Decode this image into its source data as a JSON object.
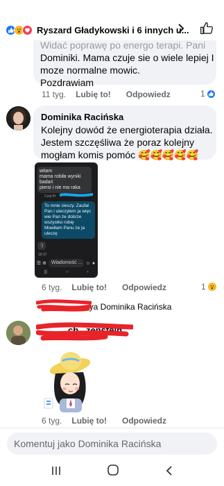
{
  "header": {
    "reactions": [
      "like",
      "wow",
      "love"
    ],
    "names": "Ryszard Gładykowski i 6 innych u...",
    "chevron_icon": "chevron-right-icon",
    "like_icon": "thumbs-up-icon"
  },
  "comment1": {
    "text_lines": [
      "Widać poprawę po energo terapi. Pani",
      "Dominiki. Mama czuje sie o wiele lepiej I",
      "moze normalne mowic.",
      "Pozdrawiam"
    ],
    "time": "11 tyg.",
    "like": "Lubię to!",
    "reply": "Odpowiedz",
    "reaction_count": "1"
  },
  "comment2": {
    "author": "Dominika Racińska",
    "text_lines": [
      "Kolejny dowód że energioterapia działa.",
      "Jestem szczęśliwa że poraz kolejny",
      "mogłam komis pomóc 🥰🥰🥰🥰🥰"
    ],
    "time": "6 tyg.",
    "like": "Lubię to!",
    "reply": "Odpowiedz",
    "reaction_count": "1",
    "image": {
      "msg1_lines": [
        "witam",
        "mama robiła wyniki badań",
        "piersi i nie ma raka"
      ],
      "czat": "Czat Pr",
      "msg2": "To mnie cieszy. Zaufał Pan i uleczyłem ja więc wie Pan że dobrze wszystko robię Mowiłam Panu że ja uleczę",
      "smile": ":)",
      "timestamp": "18:37",
      "input_placeholder": "Wiadomość ..."
    }
  },
  "reply_line": {
    "tail": "aya Dominika Racińska"
  },
  "comment3": {
    "author_visible": "ch...zenstein",
    "time": "6 tyg.",
    "like": "Lubię to!",
    "reply": "Odpowiedz"
  },
  "composer": {
    "placeholder": "Komentuj jako Dominika Racińska"
  },
  "colors": {
    "bubble": "#f0f2f5",
    "link_blue": "#1877f2",
    "muted": "#65676b",
    "scribble_red": "#e8232a"
  }
}
